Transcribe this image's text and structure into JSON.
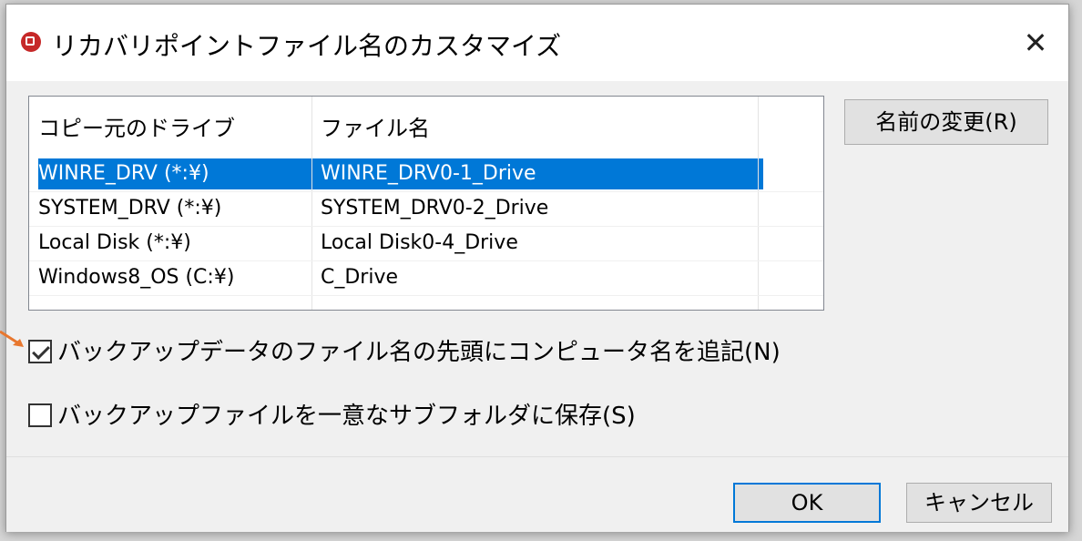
{
  "window": {
    "title": "リカバリポイントファイル名のカスタマイズ",
    "close_label": "✕"
  },
  "table": {
    "columns": [
      "コピー元のドライブ",
      "ファイル名"
    ],
    "rows": [
      {
        "drive": "WINRE_DRV (*:¥)",
        "file": "WINRE_DRV0-1_Drive",
        "selected": true
      },
      {
        "drive": "SYSTEM_DRV (*:¥)",
        "file": "SYSTEM_DRV0-2_Drive",
        "selected": false
      },
      {
        "drive": "Local Disk (*:¥)",
        "file": "Local Disk0-4_Drive",
        "selected": false
      },
      {
        "drive": "Windows8_OS (C:¥)",
        "file": "C_Drive",
        "selected": false
      }
    ]
  },
  "buttons": {
    "rename": "名前の変更(R)",
    "ok": "OK",
    "cancel": "キャンセル"
  },
  "options": {
    "prefix_computer_name": {
      "label": "バックアップデータのファイル名の先頭にコンピュータ名を追記(N)",
      "checked": true
    },
    "unique_subfolder": {
      "label": "バックアップファイルを一意なサブフォルダに保存(S)",
      "checked": false
    }
  },
  "colors": {
    "selection": "#0078d7",
    "annotation_arrow": "#e8772e",
    "app_icon": "#c62828"
  }
}
